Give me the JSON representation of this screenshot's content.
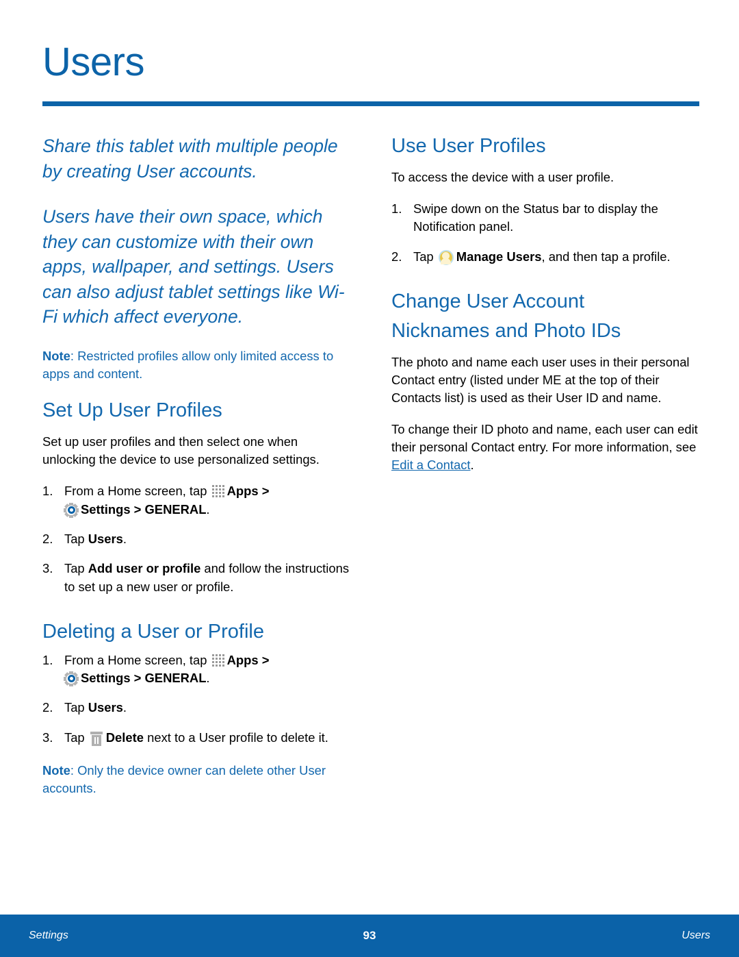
{
  "header": {
    "title": "Users"
  },
  "left_column": {
    "lede_1": "Share this tablet with multiple people by creating User accounts.",
    "lede_2": "Users have their own space, which they can customize with their own apps, wallpaper, and settings. Users can also adjust tablet settings like Wi-Fi which affect everyone.",
    "note_1": {
      "label": "Note",
      "text": ": Restricted profiles allow only limited access to apps and content."
    },
    "set_up": {
      "heading": "Set Up User Profiles",
      "intro": "Set up user profiles and then select one when unlocking the device to use personalized settings.",
      "step1": {
        "num": "1.",
        "text_a": "From a Home screen, tap",
        "apps_label": "Apps",
        "gt_1": ">",
        "settings_label": "Settings > GENERAL",
        "period": "."
      },
      "step2": {
        "num": "2.",
        "text_a": "Tap",
        "bold": "Users",
        "period": "."
      },
      "step3": {
        "num": "3.",
        "text_a": "Tap",
        "bold": "Add user or profile",
        "text_b": "and follow the instructions to set up a new user or profile."
      }
    },
    "deleting": {
      "heading": "Deleting a User or Profile",
      "step1": {
        "num": "1.",
        "text_a": "From a Home screen, tap",
        "apps_label": "Apps",
        "gt_1": ">",
        "settings_label": "Settings > GENERAL",
        "period": "."
      },
      "step2": {
        "num": "2.",
        "text_a": "Tap",
        "bold": "Users",
        "period": "."
      },
      "step3": {
        "num": "3.",
        "text_a": "Tap",
        "bold": "Delete",
        "text_b": "next to a User profile to delete it."
      },
      "note": {
        "label": "Note",
        "text": ": Only the device owner can delete other User accounts."
      }
    }
  },
  "right_column": {
    "use_profiles": {
      "heading": "Use User Profiles",
      "intro": "To access the device with a user profile.",
      "step1": {
        "num": "1.",
        "text": "Swipe down on the Status bar to display the Notification panel."
      },
      "step2": {
        "num": "2.",
        "text_a": "Tap",
        "bold": "Manage Users",
        "text_b": ", and then tap a profile."
      }
    },
    "change_account": {
      "heading_line1": "Change User Account",
      "heading_line2": "Nicknames and Photo IDs",
      "para_1": "The photo and name each user uses in their personal Contact entry (listed under ME at the top of their Contacts list) is used as their User ID and name.",
      "para_2_a": "To change their ID photo and name, each user can edit their personal Contact entry. For more information, see ",
      "para_2_link": "Edit a Contact",
      "para_2_b": "."
    }
  },
  "footer": {
    "left": "Settings",
    "page_number": "93",
    "right": "Users"
  },
  "colors": {
    "brand_blue": "#0c63a8",
    "heading_blue": "#1368ae",
    "footer_blue": "#0b62a8",
    "icon_gray": "#b0b0b0",
    "user_icon_gold": "#e8c84a"
  }
}
